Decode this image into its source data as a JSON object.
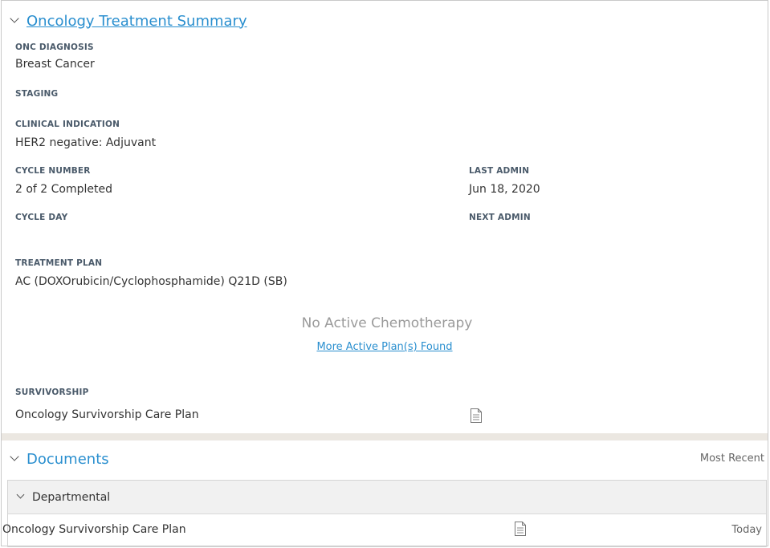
{
  "summary": {
    "title": "Oncology Treatment Summary",
    "onc_diagnosis_label": "ONC DIAGNOSIS",
    "onc_diagnosis_value": "Breast Cancer",
    "staging_label": "STAGING",
    "clinical_indication_label": "CLINICAL INDICATION",
    "clinical_indication_value": "HER2 negative: Adjuvant",
    "cycle_number_label": "CYCLE NUMBER",
    "cycle_number_value": "2 of 2 Completed",
    "last_admin_label": "LAST ADMIN",
    "last_admin_value": "Jun 18, 2020",
    "cycle_day_label": "CYCLE DAY",
    "next_admin_label": "NEXT ADMIN",
    "treatment_plan_label": "TREATMENT PLAN",
    "treatment_plan_value": "AC (DOXOrubicin/Cyclophosphamide) Q21D (SB)",
    "no_active_chemo": "No Active Chemotherapy",
    "more_plans_link": "More Active Plan(s) Found",
    "survivorship_label": "SURVIVORSHIP",
    "survivorship_value": "Oncology Survivorship Care Plan"
  },
  "documents": {
    "title": "Documents",
    "sort_label": "Most Recent",
    "groups": [
      {
        "label": "Departmental",
        "items": [
          {
            "name": "Oncology Survivorship Care Plan",
            "date": "Today"
          }
        ]
      }
    ]
  },
  "icons": {
    "collapse": "chevron-down-icon",
    "document": "document-icon"
  },
  "colors": {
    "accent": "#2a8fcf",
    "label": "#4a5a6a",
    "muted": "#9a9a9a",
    "separator": "#ebe7e1"
  }
}
